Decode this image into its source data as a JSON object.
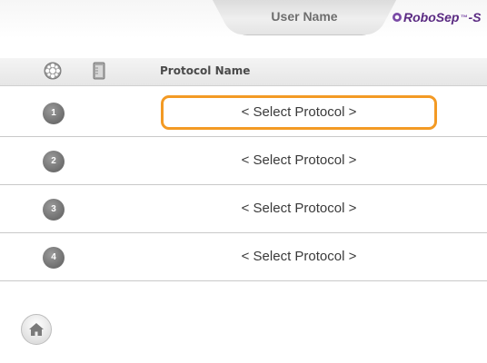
{
  "header": {
    "user_name": "User Name",
    "brand": {
      "name": "RoboSep",
      "suffix": "-S",
      "sup_mark": "™",
      "color": "#5a2a82"
    }
  },
  "table": {
    "column_icons": [
      "carousel-icon",
      "tube-icon"
    ],
    "column_title": "Protocol Name"
  },
  "quadrants": [
    {
      "number": "1",
      "protocol_label": "< Select Protocol >",
      "selected": true
    },
    {
      "number": "2",
      "protocol_label": "< Select Protocol >",
      "selected": false
    },
    {
      "number": "3",
      "protocol_label": "< Select Protocol >",
      "selected": false
    },
    {
      "number": "4",
      "protocol_label": "< Select Protocol >",
      "selected": false
    }
  ],
  "footer": {
    "home_icon": "home-icon"
  },
  "colors": {
    "selection_outline": "#f39a24",
    "number_badge": "#7a7a7a",
    "divider": "#c9c9c9"
  }
}
